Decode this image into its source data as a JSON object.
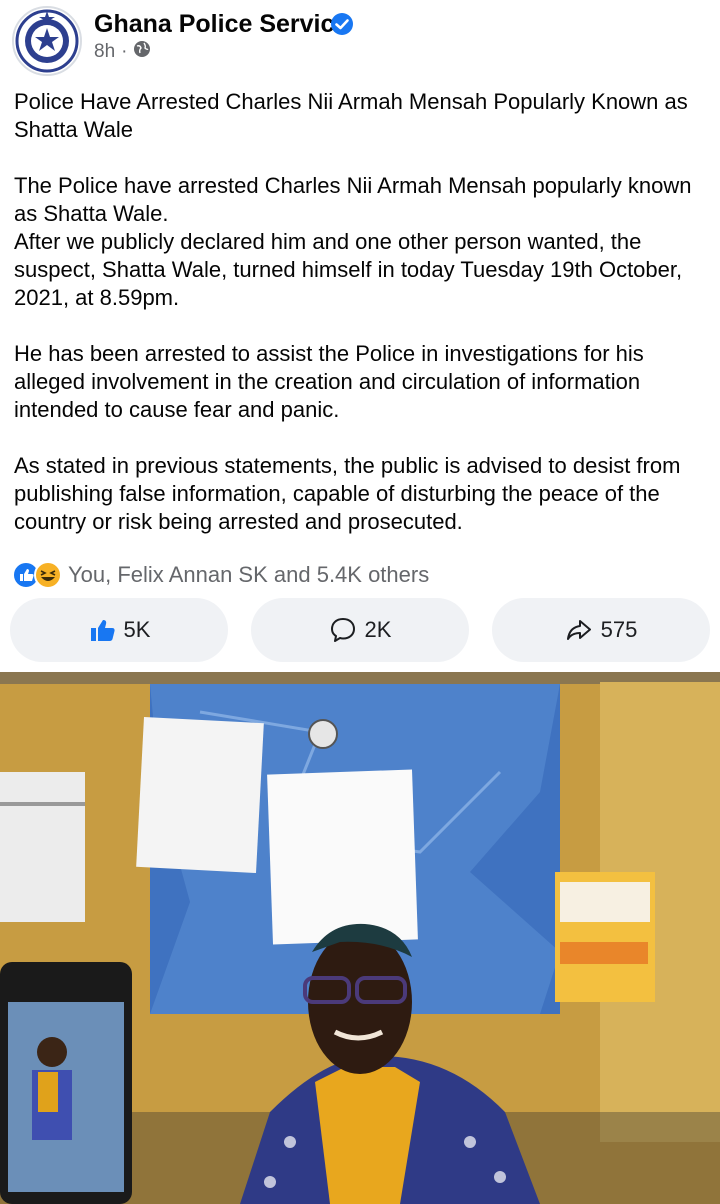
{
  "header": {
    "page_name": "Ghana Police Service",
    "time": "8h",
    "separator": "·",
    "avatar_icon": "police-badge-icon",
    "verified_icon": "verified-badge-icon",
    "audience_icon": "globe-icon"
  },
  "post": {
    "title": "Police Have Arrested Charles Nii Armah Mensah Popularly Known as Shatta Wale",
    "paragraphs": [
      "The Police have arrested Charles Nii Armah Mensah popularly known as Shatta Wale.",
      "After we publicly declared him and one other person wanted, the suspect, Shatta Wale, turned himself in today Tuesday 19th October, 2021, at 8.59pm.",
      "He has been arrested to assist the Police in investigations for his alleged involvement in the creation and circulation of information intended to cause fear and panic.",
      "As stated in previous statements, the public is advised to desist from publishing false information, capable of disturbing the peace of the country or risk being arrested and prosecuted."
    ]
  },
  "reactions": {
    "summary": "You, Felix Annan SK and 5.4K others",
    "icons": [
      "like-reaction-icon",
      "haha-reaction-icon"
    ]
  },
  "actions": {
    "like_count": "5K",
    "comment_count": "2K",
    "share_count": "575"
  },
  "colors": {
    "accent_blue": "#1877f2",
    "muted_text": "#65676b",
    "button_bg": "#f0f2f5"
  }
}
